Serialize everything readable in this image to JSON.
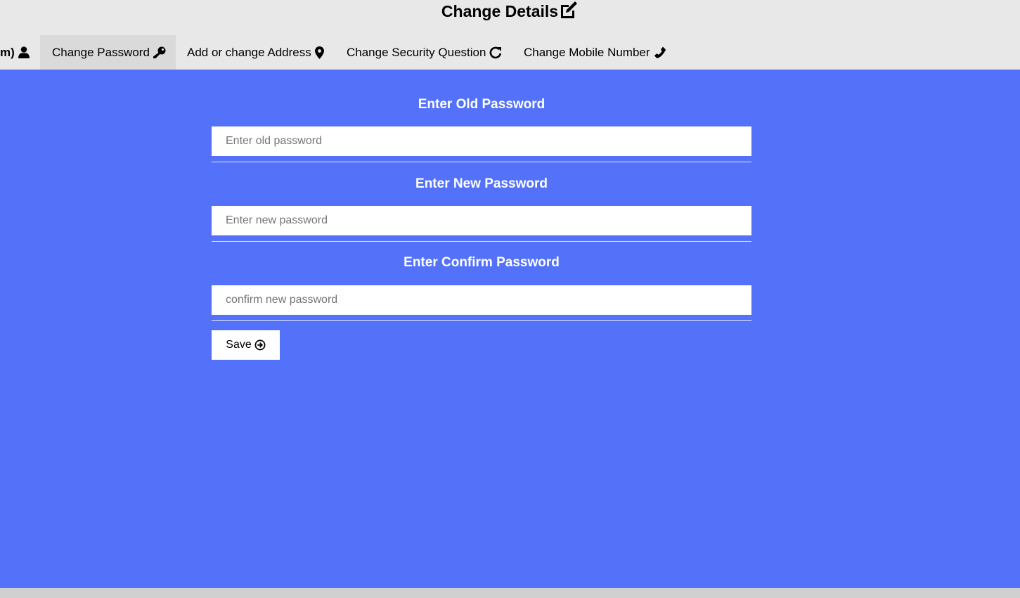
{
  "header": {
    "title": "Change Details",
    "title_icon": "edit-icon"
  },
  "tabs": [
    {
      "label": "m)",
      "icon": "user-icon",
      "active": false
    },
    {
      "label": "Change Password",
      "icon": "key-icon",
      "active": true
    },
    {
      "label": "Add or change Address",
      "icon": "map-marker-icon",
      "active": false
    },
    {
      "label": "Change Security Question",
      "icon": "redo-icon",
      "active": false
    },
    {
      "label": "Change Mobile Number",
      "icon": "phone-icon",
      "active": false
    }
  ],
  "form": {
    "old": {
      "label": "Enter Old Password",
      "placeholder": "Enter old password",
      "value": ""
    },
    "new": {
      "label": "Enter New Password",
      "placeholder": "Enter new password",
      "value": ""
    },
    "confirm": {
      "label": "Enter Confirm Password",
      "placeholder": "confirm new password",
      "value": ""
    },
    "save_label": "Save",
    "save_icon": "arrow-circle-right-icon"
  },
  "colors": {
    "main_background": "#5472f9",
    "header_background": "#e8e8e8",
    "active_tab": "#dadada"
  }
}
